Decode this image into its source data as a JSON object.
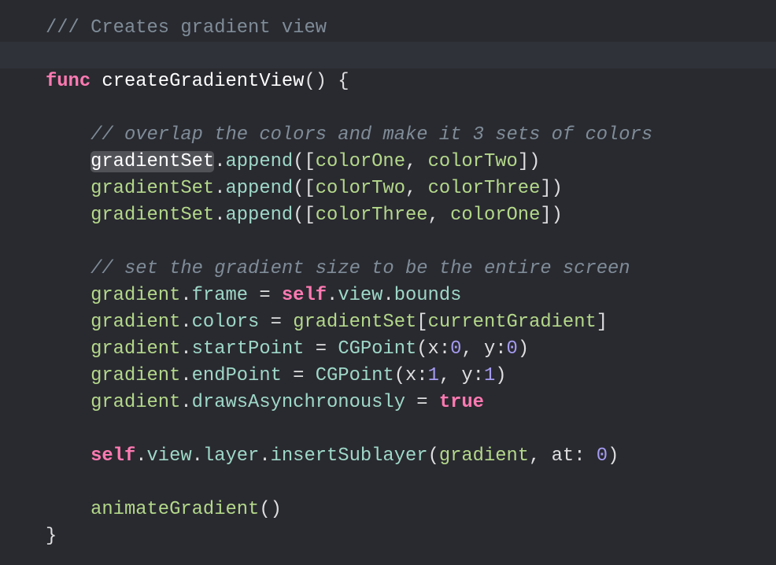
{
  "editor": {
    "colors": {
      "background": "#292a30",
      "current_line": "#2f3239",
      "keyword": "#ff7ab2",
      "comment": "#7f8c98",
      "variable": "#b4d88a",
      "property": "#9fd8c8",
      "number": "#a59bf0"
    },
    "current_line_index": 1,
    "lines": [
      [
        [
          "comment",
          "/// Creates gradient view"
        ]
      ],
      [],
      [
        [
          "keyword",
          "func"
        ],
        [
          "plain",
          " "
        ],
        [
          "func",
          "createGradientView"
        ],
        [
          "plain",
          "() {"
        ]
      ],
      [],
      [
        [
          "plain",
          "    "
        ],
        [
          "comment-inline",
          "// overlap the colors and make it 3 sets of colors"
        ]
      ],
      [
        [
          "plain",
          "    "
        ],
        [
          "var",
          "gradientSet",
          "sel"
        ],
        [
          "plain",
          "."
        ],
        [
          "prop",
          "append"
        ],
        [
          "plain",
          "(["
        ],
        [
          "var",
          "colorOne"
        ],
        [
          "plain",
          ", "
        ],
        [
          "var",
          "colorTwo"
        ],
        [
          "plain",
          "])"
        ]
      ],
      [
        [
          "plain",
          "    "
        ],
        [
          "var",
          "gradientSet"
        ],
        [
          "plain",
          "."
        ],
        [
          "prop",
          "append"
        ],
        [
          "plain",
          "(["
        ],
        [
          "var",
          "colorTwo"
        ],
        [
          "plain",
          ", "
        ],
        [
          "var",
          "colorThree"
        ],
        [
          "plain",
          "])"
        ]
      ],
      [
        [
          "plain",
          "    "
        ],
        [
          "var",
          "gradientSet"
        ],
        [
          "plain",
          "."
        ],
        [
          "prop",
          "append"
        ],
        [
          "plain",
          "(["
        ],
        [
          "var",
          "colorThree"
        ],
        [
          "plain",
          ", "
        ],
        [
          "var",
          "colorOne"
        ],
        [
          "plain",
          "])"
        ]
      ],
      [],
      [
        [
          "plain",
          "    "
        ],
        [
          "comment-inline",
          "// set the gradient size to be the entire screen"
        ]
      ],
      [
        [
          "plain",
          "    "
        ],
        [
          "var",
          "gradient"
        ],
        [
          "plain",
          "."
        ],
        [
          "prop",
          "frame"
        ],
        [
          "plain",
          " = "
        ],
        [
          "keyword",
          "self"
        ],
        [
          "plain",
          "."
        ],
        [
          "prop",
          "view"
        ],
        [
          "plain",
          "."
        ],
        [
          "prop",
          "bounds"
        ]
      ],
      [
        [
          "plain",
          "    "
        ],
        [
          "var",
          "gradient"
        ],
        [
          "plain",
          "."
        ],
        [
          "prop",
          "colors"
        ],
        [
          "plain",
          " = "
        ],
        [
          "var",
          "gradientSet"
        ],
        [
          "plain",
          "["
        ],
        [
          "var",
          "currentGradient"
        ],
        [
          "plain",
          "]"
        ]
      ],
      [
        [
          "plain",
          "    "
        ],
        [
          "var",
          "gradient"
        ],
        [
          "plain",
          "."
        ],
        [
          "prop",
          "startPoint"
        ],
        [
          "plain",
          " = "
        ],
        [
          "type",
          "CGPoint"
        ],
        [
          "plain",
          "(x:"
        ],
        [
          "num",
          "0"
        ],
        [
          "plain",
          ", y:"
        ],
        [
          "num",
          "0"
        ],
        [
          "plain",
          ")"
        ]
      ],
      [
        [
          "plain",
          "    "
        ],
        [
          "var",
          "gradient"
        ],
        [
          "plain",
          "."
        ],
        [
          "prop",
          "endPoint"
        ],
        [
          "plain",
          " = "
        ],
        [
          "type",
          "CGPoint"
        ],
        [
          "plain",
          "(x:"
        ],
        [
          "num",
          "1"
        ],
        [
          "plain",
          ", y:"
        ],
        [
          "num",
          "1"
        ],
        [
          "plain",
          ")"
        ]
      ],
      [
        [
          "plain",
          "    "
        ],
        [
          "var",
          "gradient"
        ],
        [
          "plain",
          "."
        ],
        [
          "prop",
          "drawsAsynchronously"
        ],
        [
          "plain",
          " = "
        ],
        [
          "keyword",
          "true"
        ]
      ],
      [],
      [
        [
          "plain",
          "    "
        ],
        [
          "keyword",
          "self"
        ],
        [
          "plain",
          "."
        ],
        [
          "prop",
          "view"
        ],
        [
          "plain",
          "."
        ],
        [
          "prop",
          "layer"
        ],
        [
          "plain",
          "."
        ],
        [
          "prop",
          "insertSublayer"
        ],
        [
          "plain",
          "("
        ],
        [
          "var",
          "gradient"
        ],
        [
          "plain",
          ", at: "
        ],
        [
          "num",
          "0"
        ],
        [
          "plain",
          ")"
        ]
      ],
      [],
      [
        [
          "plain",
          "    "
        ],
        [
          "var",
          "animateGradient"
        ],
        [
          "plain",
          "()"
        ]
      ],
      [
        [
          "plain",
          "}"
        ]
      ]
    ]
  }
}
